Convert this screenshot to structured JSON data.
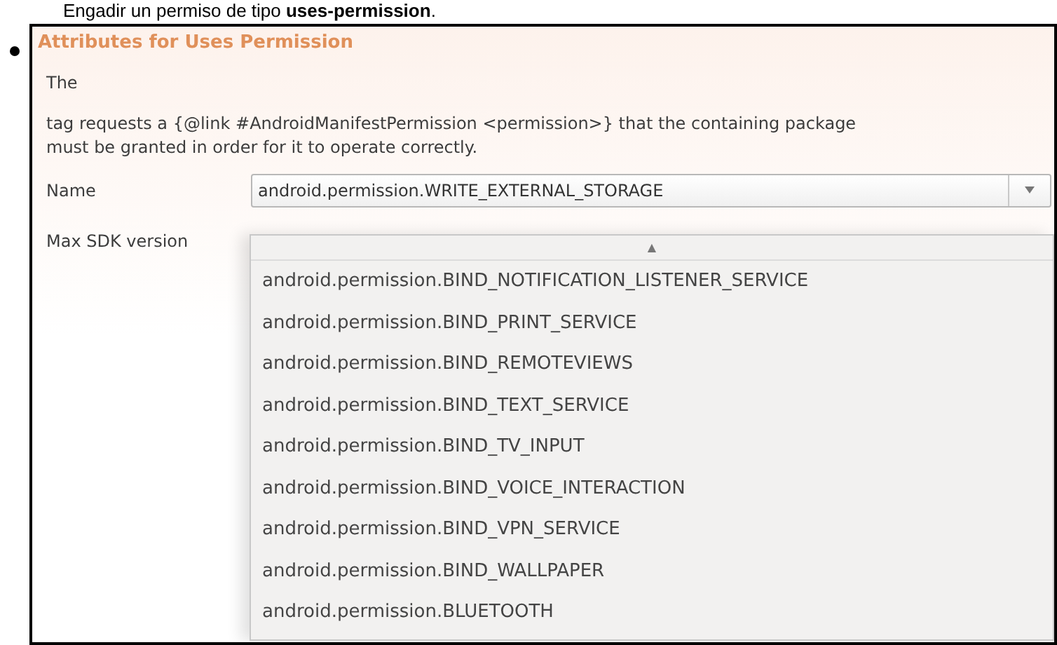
{
  "intro": "Engadir un permiso de tipo **uses-permission**.",
  "section_title": "Attributes for Uses Permission",
  "description_lines": [
    "The",
    "tag requests a {@link #AndroidManifestPermission <permission>} that the containing package must be granted in order for it to operate correctly."
  ],
  "fields": [
    {
      "label": "Name",
      "value": "android.permission.WRITE_EXTERNAL_STORAGE"
    },
    {
      "label": "Max SDK version"
    }
  ],
  "dropdown": {
    "scroll_up": "▲",
    "options": [
      {
        "label": "android.permission.BIND_NOTIFICATION_LISTENER_SERVICE"
      },
      {
        "label": "android.permission.BIND_PRINT_SERVICE"
      },
      {
        "label": "android.permission.BIND_REMOTEVIEWS"
      },
      {
        "label": "android.permission.BIND_TEXT_SERVICE"
      },
      {
        "label": "android.permission.BIND_TV_INPUT"
      },
      {
        "label": "android.permission.BIND_VOICE_INTERACTION"
      },
      {
        "label": "android.permission.BIND_VPN_SERVICE"
      },
      {
        "label": "android.permission.BIND_WALLPAPER"
      },
      {
        "label": "android.permission.BLUETOOTH"
      }
    ]
  }
}
